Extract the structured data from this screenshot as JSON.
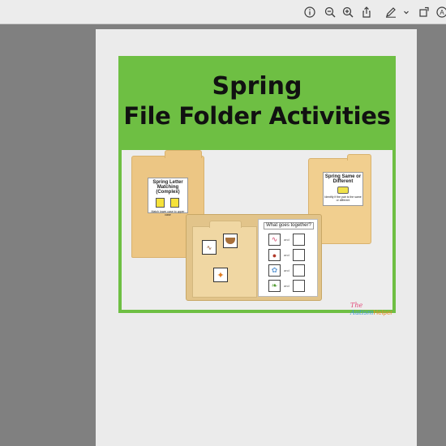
{
  "toolbar": {
    "icons": [
      "info-icon",
      "zoom-out-icon",
      "zoom-in-icon",
      "share-icon",
      "markup-pen-icon",
      "chevron-down-icon",
      "rotate-icon",
      "profile-icon"
    ]
  },
  "cover": {
    "title_line1": "Spring",
    "title_line2": "File Folder Activities",
    "background_color": "#6ebf43"
  },
  "folders": {
    "left_card": {
      "title": "Spring Letter Matching (Complex)",
      "caption": "Match lower case to upper case"
    },
    "right_card": {
      "title": "Spring Same or Different",
      "caption": "Identify if the pair is the same or different"
    },
    "worksheet": {
      "question": "What goes together?",
      "row_connector": "and"
    }
  },
  "brand": {
    "part1": "The",
    "part2": "Autism",
    "part3": "Helper"
  }
}
